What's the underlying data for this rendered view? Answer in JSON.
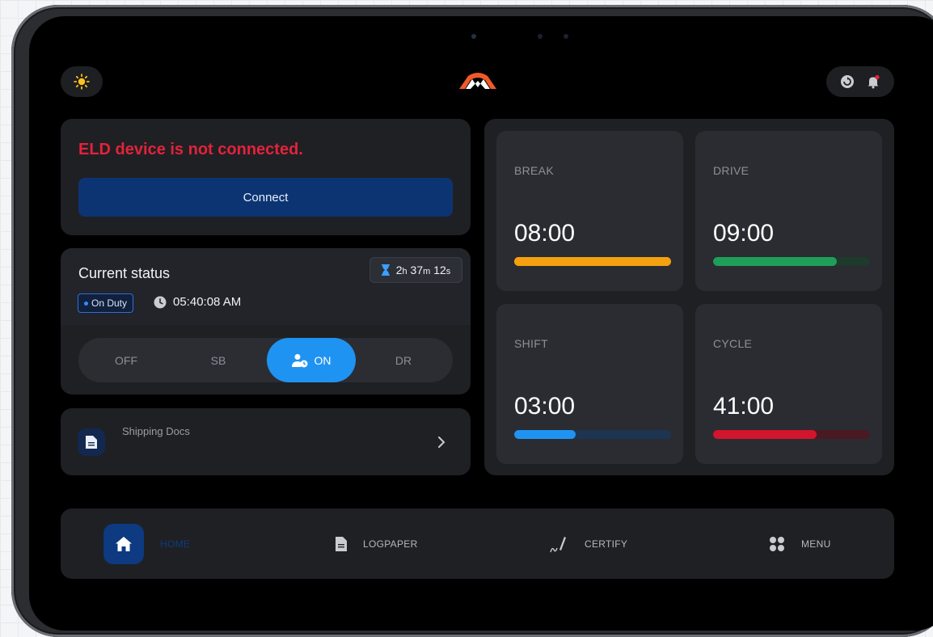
{
  "header": {
    "theme_icon": "sun-icon",
    "logo_icon": "brand-logo-icon",
    "sync_icon": "sync-icon",
    "notification_icon": "bell-icon"
  },
  "eld": {
    "message": "ELD device is not connected.",
    "connect_label": "Connect"
  },
  "status": {
    "title": "Current status",
    "timer": {
      "h": "2",
      "h_unit": "h",
      "m": "37",
      "m_unit": "m",
      "s": "12",
      "s_unit": "s"
    },
    "duty_badge": "On Duty",
    "time": "05:40:08 AM",
    "modes": [
      {
        "label": "OFF",
        "active": false
      },
      {
        "label": "SB",
        "active": false
      },
      {
        "label": "ON",
        "active": true
      },
      {
        "label": "DR",
        "active": false
      }
    ]
  },
  "docs": {
    "label": "Shipping Docs"
  },
  "timers": [
    {
      "label": "BREAK",
      "value": "08:00",
      "progress": 1.0,
      "color": "#f5a00f",
      "track": "#f5a00f"
    },
    {
      "label": "DRIVE",
      "value": "09:00",
      "progress": 0.79,
      "color": "#1f9e5a",
      "track": "#1d3a2c"
    },
    {
      "label": "SHIFT",
      "value": "03:00",
      "progress": 0.39,
      "color": "#1f93f2",
      "track": "#1d3550"
    },
    {
      "label": "CYCLE",
      "value": "41:00",
      "progress": 0.66,
      "color": "#d1152d",
      "track": "#4a1a22"
    }
  ],
  "nav": {
    "home": "HOME",
    "logpaper": "LOGPAPER",
    "certify": "CERTIFY",
    "menu": "MENU"
  },
  "colors": {
    "accent": "#1f93f2",
    "error": "#e3223b",
    "primary_dark": "#0c3473"
  }
}
